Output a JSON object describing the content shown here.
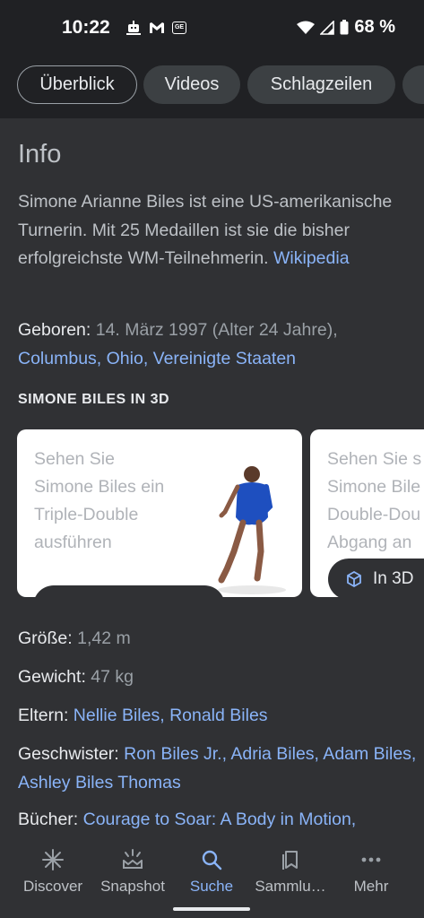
{
  "status_bar": {
    "time": "10:22",
    "left_icons": [
      "robot-icon",
      "gmail-icon",
      "news-icon"
    ],
    "news_badge": "GE",
    "battery_percent": "68 %"
  },
  "tabs": [
    {
      "label": "Überblick",
      "active": true
    },
    {
      "label": "Videos",
      "active": false
    },
    {
      "label": "Schlagzeilen",
      "active": false
    },
    {
      "label": "",
      "active": false
    }
  ],
  "info": {
    "title": "Info",
    "description": "Simone Arianne Biles ist eine US-amerikanische Turnerin. Mit 25 Medaillen ist sie die bisher erfolgreichste WM-Teilnehmerin.",
    "source_link": "Wikipedia",
    "born_label": "Geboren:",
    "born_value": "14. März 1997 (Alter 24 Jahre),",
    "born_place": "Columbus, Ohio, Vereinigte Staaten"
  },
  "section_3d": {
    "heading": "SIMONE BILES IN 3D",
    "cards": [
      {
        "text": "Sehen Sie Simone Biles ein Triple-Double ausführen"
      },
      {
        "text": "Sehen Sie s Simone Bile Double-Dou Abgang an",
        "button_label": "In 3D"
      }
    ]
  },
  "facts": {
    "height_label": "Größe:",
    "height_value": "1,42 m",
    "weight_label": "Gewicht:",
    "weight_value": "47 kg",
    "parents_label": "Eltern:",
    "parents_value": "Nellie Biles, Ronald Biles",
    "siblings_label": "Geschwister:",
    "siblings_value": "Ron Biles Jr., Adria Biles, Adam Biles, Ashley Biles Thomas",
    "books_label": "Bücher:",
    "books_value": "Courage to Soar: A Body in Motion,"
  },
  "bottom_nav": [
    {
      "label": "Discover",
      "icon": "asterisk-icon",
      "active": false
    },
    {
      "label": "Snapshot",
      "icon": "snapshot-icon",
      "active": false
    },
    {
      "label": "Suche",
      "icon": "search-icon",
      "active": true
    },
    {
      "label": "Sammlu…",
      "icon": "collections-icon",
      "active": false
    },
    {
      "label": "Mehr",
      "icon": "more-icon",
      "active": false
    }
  ],
  "colors": {
    "background": "#202124",
    "card": "#303134",
    "link": "#8ab4f8",
    "text": "#e8eaed",
    "muted": "#9aa0a6"
  }
}
